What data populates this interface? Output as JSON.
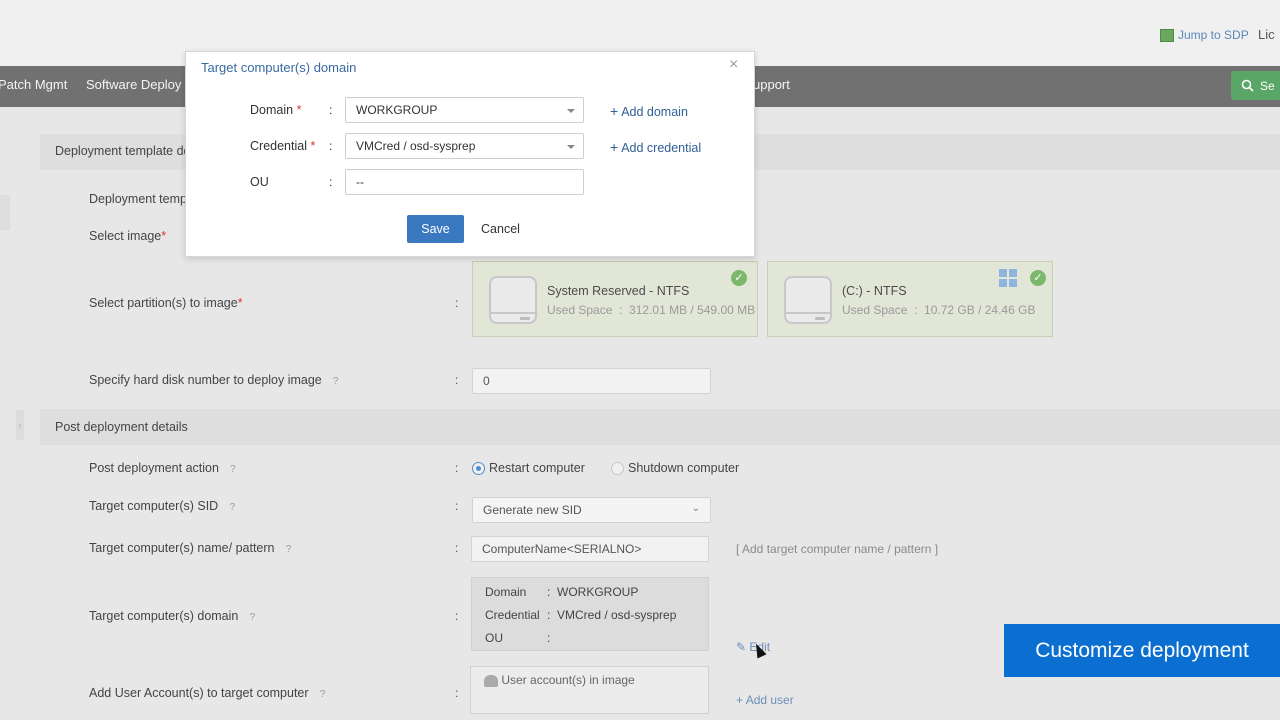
{
  "topbar": {
    "jump_label": "Jump to SDP",
    "license_label": "Lic"
  },
  "nav": {
    "items": [
      "Patch Mgmt",
      "Software Deploy",
      "upport"
    ],
    "search_label": "Se"
  },
  "sections": {
    "deployment_title": "Deployment template de",
    "post_title": "Post deployment details"
  },
  "fields": {
    "template_name_label": "Deployment temp",
    "select_image_label": "Select image",
    "select_partition_label": "Select partition(s) to image",
    "hard_disk_label": "Specify hard disk number to deploy image",
    "hard_disk_value": "0",
    "post_action_label": "Post deployment action",
    "restart_label": "Restart computer",
    "shutdown_label": "Shutdown computer",
    "sid_label": "Target computer(s) SID",
    "sid_value": "Generate new SID",
    "name_label": "Target computer(s) name/ pattern",
    "name_value": "ComputerName<SERIALNO>",
    "name_link": "[ Add target computer name / pattern ]",
    "domain_label": "Target computer(s) domain",
    "edit_label": "Edit",
    "user_label": "Add User Account(s) to target computer",
    "user_box_label": "User account(s) in image",
    "add_user_label": "Add user"
  },
  "partitions": [
    {
      "name": "System Reserved - NTFS",
      "used_label": "Used Space",
      "used_value": "312.01 MB / 549.00 MB"
    },
    {
      "name": "(C:) - NTFS",
      "used_label": "Used Space",
      "used_value": "10.72 GB / 24.46 GB"
    }
  ],
  "domain_box": {
    "domain_key": "Domain",
    "domain_value": "WORKGROUP",
    "credential_key": "Credential",
    "credential_value": "VMCred / osd-sysprep",
    "ou_key": "OU",
    "ou_value": ""
  },
  "modal": {
    "title": "Target computer(s) domain",
    "close": "×",
    "domain_label": "Domain",
    "domain_value": "WORKGROUP",
    "add_domain": "Add domain",
    "credential_label": "Credential",
    "credential_value": "VMCred / osd-sysprep",
    "add_credential": "Add credential",
    "ou_label": "OU",
    "ou_value": "--",
    "save": "Save",
    "cancel": "Cancel"
  },
  "overlay": {
    "badge": "Customize deployment"
  },
  "colors": {
    "nav_bg": "#717171",
    "primary": "#3a79bf",
    "badge": "#0b6fd1",
    "check": "#7bb86c"
  }
}
